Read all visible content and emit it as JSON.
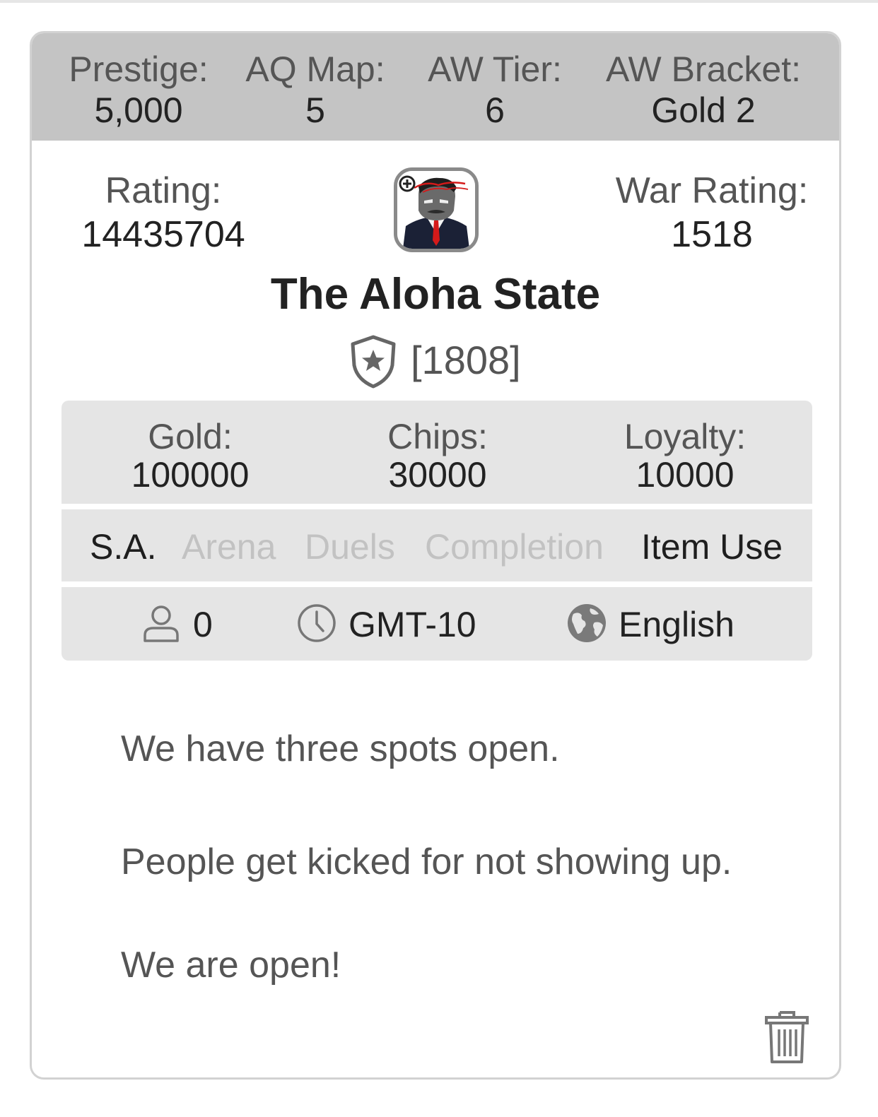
{
  "header": {
    "prestige": {
      "label": "Prestige:",
      "value": "5,000"
    },
    "aq_map": {
      "label": "AQ Map:",
      "value": "5"
    },
    "aw_tier": {
      "label": "AW Tier:",
      "value": "6"
    },
    "aw_bracket": {
      "label": "AW Bracket:",
      "value": "Gold 2"
    }
  },
  "rating": {
    "label": "Rating:",
    "value": "14435704"
  },
  "war_rating": {
    "label": "War Rating:",
    "value": "1518"
  },
  "alliance": {
    "name": "The Aloha State",
    "tag": "[1808]",
    "avatar_icon": "hulk-in-suit-avatar"
  },
  "requirements": {
    "gold": {
      "label": "Gold:",
      "value": "100000"
    },
    "chips": {
      "label": "Chips:",
      "value": "30000"
    },
    "loyalty": {
      "label": "Loyalty:",
      "value": "10000"
    }
  },
  "activities": [
    {
      "label": "S.A.",
      "active": true
    },
    {
      "label": "Arena",
      "active": false
    },
    {
      "label": "Duels",
      "active": false
    },
    {
      "label": "Completion",
      "active": false
    },
    {
      "label": "Item Use",
      "active": true
    }
  ],
  "meta": {
    "members": "0",
    "timezone": "GMT-10",
    "language": "English"
  },
  "description": [
    "We have three spots open.",
    "People get kicked for not showing up.",
    "We are open!"
  ],
  "colors": {
    "header_bg": "#c4c4c4",
    "panel_bg": "#e5e5e5",
    "active_text": "#1e1e1e",
    "inactive_text": "#c2c2c2"
  }
}
